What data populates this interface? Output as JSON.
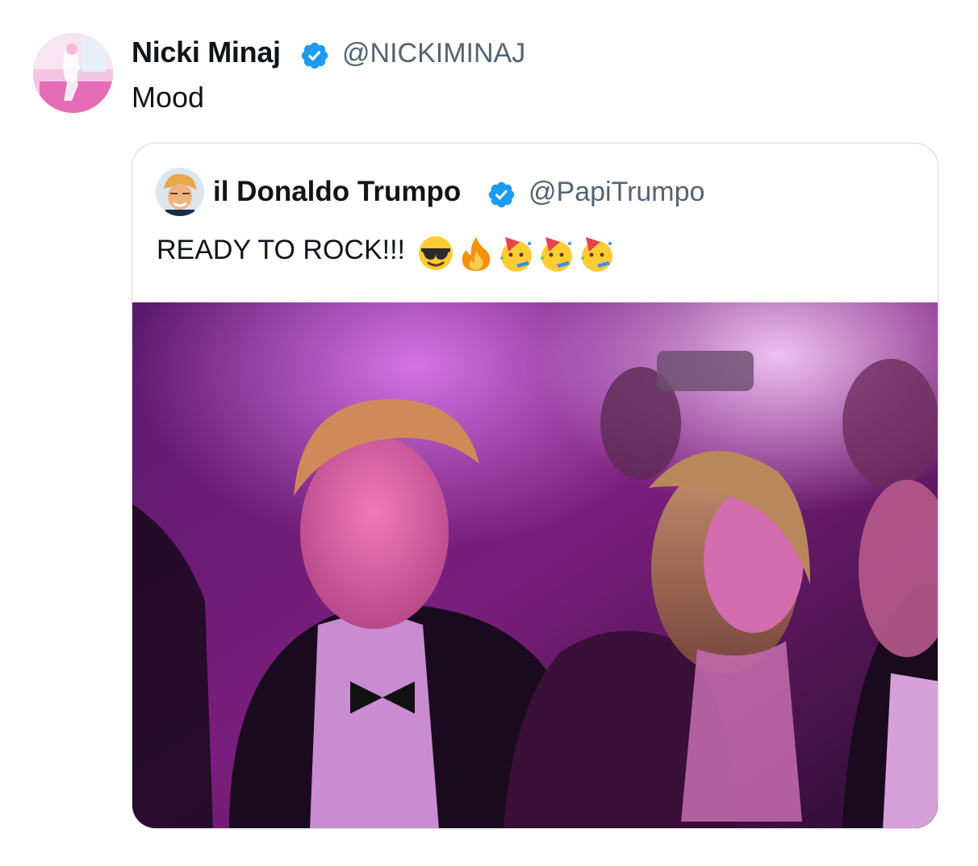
{
  "tweet": {
    "author_name": "Nicki Minaj",
    "author_handle": "@NICKIMINAJ",
    "text": "Mood",
    "verified": true
  },
  "quoted_tweet": {
    "author_name": "il Donaldo Trumpo",
    "author_handle": "@PapiTrumpo",
    "verified": true,
    "text": "READY TO ROCK!!!",
    "emojis": [
      "smiling-face-with-sunglasses",
      "fire",
      "partying-face",
      "partying-face",
      "partying-face"
    ]
  },
  "colors": {
    "verified_badge": "#1d9bf0",
    "handle": "#536471",
    "border": "#cfd9de",
    "media_tint": "#a2158f"
  }
}
